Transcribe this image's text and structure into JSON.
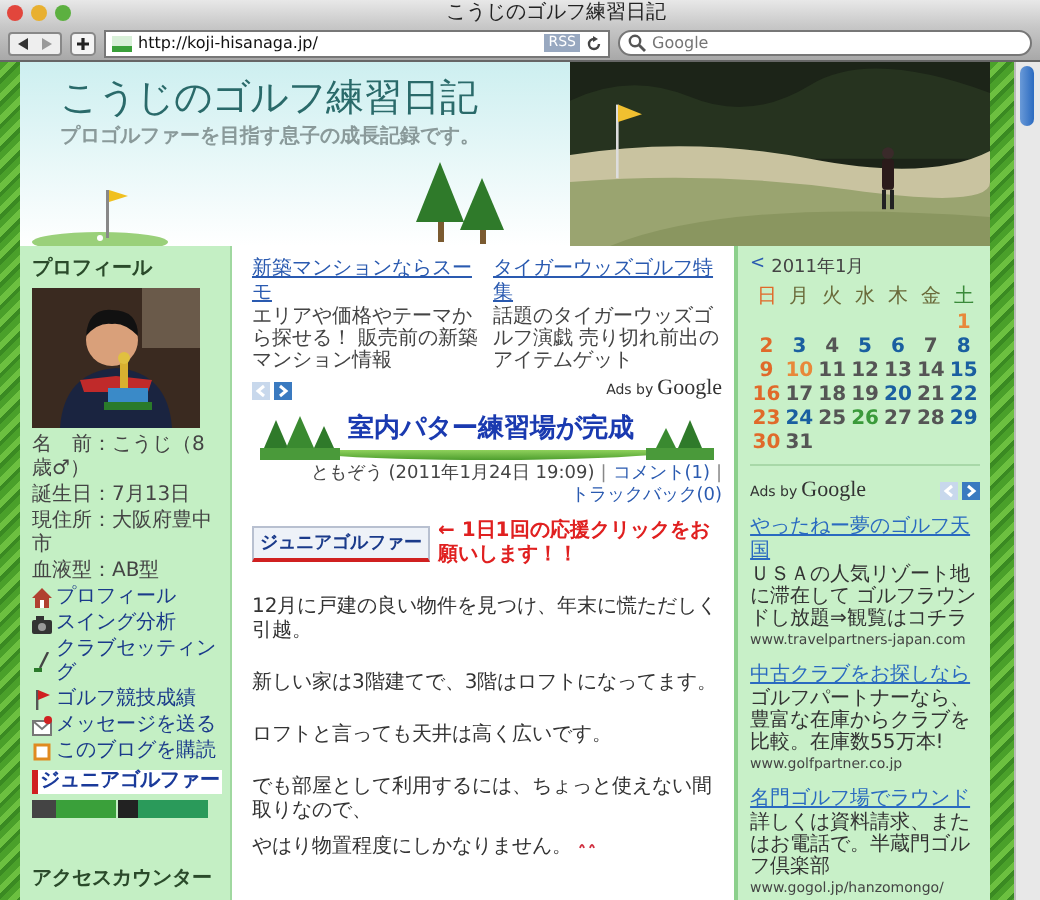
{
  "window": {
    "title": "こうじのゴルフ練習日記"
  },
  "toolbar": {
    "url": "http://koji-hisanaga.jp/",
    "rss": "RSS",
    "search_placeholder": "Google"
  },
  "header": {
    "title": "こうじのゴルフ練習日記",
    "subtitle": "プロゴルファーを目指す息子の成長記録です。"
  },
  "profile": {
    "heading": "プロフィール",
    "photo": {
      "kind": "picture"
    },
    "info": [
      "名　前：こうじ（8歳♂）",
      "誕生日：7月13日",
      "現住所：大阪府豊中市",
      "血液型：AB型"
    ],
    "links": [
      {
        "label": "プロフィール",
        "kind": "house"
      },
      {
        "label": "スイング分析",
        "kind": "camera"
      },
      {
        "label": "クラブセッティング",
        "kind": "club"
      },
      {
        "label": "ゴルフ競技成績",
        "kind": "flag"
      },
      {
        "label": "メッセージを送る",
        "kind": "mail"
      },
      {
        "label": "このブログを購読",
        "kind": "square"
      }
    ],
    "banner": "ジュニアゴルファー",
    "counter_heading": "アクセスカウンター"
  },
  "ads": {
    "items": [
      {
        "title": "新築マンションならスーモ",
        "text": "エリアや価格やテーマから探せる！ 販売前の新築マンション情報"
      },
      {
        "title": "タイガーウッズゴルフ特集",
        "text": "話題のタイガーウッズゴルフ演戯 売り切れ前出のアイテムゲット"
      }
    ],
    "ads_by": "Ads by",
    "brand": "Google"
  },
  "post": {
    "title": "室内パター練習場が完成",
    "meta": [
      {
        "text": "ともぞう (2011年1月24日 19:09)",
        "kind": "text"
      },
      {
        "text": "|",
        "kind": "sep"
      },
      {
        "text": "コメント(1)",
        "kind": "link"
      },
      {
        "text": "|",
        "kind": "sep"
      },
      {
        "text": "トラックバック(0)",
        "kind": "link"
      }
    ],
    "vote_button": "ジュニアゴルファー",
    "vote_text": "← 1日1回の応援クリックをお願いします！！",
    "paragraphs": [
      {
        "lines": [
          "12月に戸建の良い物件を見つけ、年末に慌ただしく引越。"
        ]
      },
      {
        "lines": [
          "新しい家は3階建てで、3階はロフトになってます。"
        ]
      },
      {
        "lines": [
          "ロフトと言っても天井は高く広いです。"
        ]
      },
      {
        "lines": [
          "でも部屋として利用するには、ちょっと使えない間取りなので、",
          "やはり物置程度にしかなりません。"
        ]
      }
    ]
  },
  "calendar": {
    "nav": "<",
    "month": "2011年1月",
    "weekdays": [
      {
        "label": "日",
        "color": "#e06a2a"
      },
      {
        "label": "月",
        "color": "#6a6a3a"
      },
      {
        "label": "火",
        "color": "#6a6a3a"
      },
      {
        "label": "水",
        "color": "#6a6a3a"
      },
      {
        "label": "木",
        "color": "#6a6a3a"
      },
      {
        "label": "金",
        "color": "#6a6a3a"
      },
      {
        "label": "土",
        "color": "#3a8a3a"
      }
    ],
    "weeks": [
      [
        {
          "d": "1",
          "color": "#e8883a"
        }
      ],
      [
        {
          "d": "2",
          "color": "#e06a2a"
        },
        {
          "d": "3",
          "color": "#1a5fa0"
        },
        {
          "d": "4",
          "color": "#555555"
        },
        {
          "d": "5",
          "color": "#1a5fa0"
        },
        {
          "d": "6",
          "color": "#1a5fa0"
        },
        {
          "d": "7",
          "color": "#555555"
        },
        {
          "d": "8",
          "color": "#1a5fa0"
        }
      ],
      [
        {
          "d": "9",
          "color": "#e06a2a"
        },
        {
          "d": "10",
          "color": "#e8883a"
        },
        {
          "d": "11",
          "color": "#555555"
        },
        {
          "d": "12",
          "color": "#555555"
        },
        {
          "d": "13",
          "color": "#555555"
        },
        {
          "d": "14",
          "color": "#555555"
        },
        {
          "d": "15",
          "color": "#1a5fa0"
        }
      ],
      [
        {
          "d": "16",
          "color": "#e06a2a"
        },
        {
          "d": "17",
          "color": "#555555"
        },
        {
          "d": "18",
          "color": "#555555"
        },
        {
          "d": "19",
          "color": "#555555"
        },
        {
          "d": "20",
          "color": "#1a5fa0"
        },
        {
          "d": "21",
          "color": "#555555"
        },
        {
          "d": "22",
          "color": "#1a5fa0"
        }
      ],
      [
        {
          "d": "23",
          "color": "#e06a2a"
        },
        {
          "d": "24",
          "color": "#1a5fa0"
        },
        {
          "d": "25",
          "color": "#555555"
        },
        {
          "d": "26",
          "color": "#3a9a3a"
        },
        {
          "d": "27",
          "color": "#555555"
        },
        {
          "d": "28",
          "color": "#555555"
        },
        {
          "d": "29",
          "color": "#1a5fa0"
        }
      ],
      [
        {
          "d": "30",
          "color": "#e06a2a"
        },
        {
          "d": "31",
          "color": "#555555"
        }
      ]
    ]
  },
  "sidebar_ads": {
    "ads_by": "Ads by",
    "brand": "Google",
    "items": [
      {
        "title": "やったねー夢のゴルフ天国",
        "text": "ＵＳＡの人気リゾート地に滞在して ゴルフラウンドし放題⇒観覧はコチラ",
        "url": "www.travelpartners-japan.com"
      },
      {
        "title": "中古クラブをお探しなら",
        "text": "ゴルフパートナーなら、豊富な在庫からクラブを比較。在庫数55万本!",
        "url": "www.golfpartner.co.jp"
      },
      {
        "title": "名門ゴルフ場でラウンド",
        "text": "詳しくは資料請求、またはお電話で。半蔵門ゴルフ倶楽部",
        "url": "www.gogol.jp/hanzomongo/"
      }
    ]
  }
}
